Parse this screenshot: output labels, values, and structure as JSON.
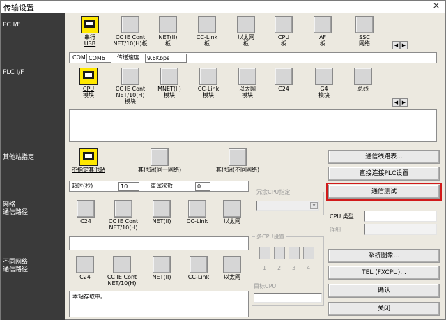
{
  "window": {
    "title": "传输设置",
    "close": "×"
  },
  "sidebar": {
    "pc_if": "PC I/F",
    "plc_if": "PLC I/F",
    "other_station": "其他站指定",
    "network_route": "网络\n通信路径",
    "diff_network_route": "不同网络\n通信路径"
  },
  "pc_if": {
    "devices": [
      {
        "label": "串行\nUSB"
      },
      {
        "label": "CC IE Cont\nNET/10(H)板"
      },
      {
        "label": "NET(II)\n板"
      },
      {
        "label": "CC-Link\n板"
      },
      {
        "label": "以太网\n板"
      },
      {
        "label": "CPU\n板"
      },
      {
        "label": "AF\n板"
      },
      {
        "label": "SSC\n网络"
      }
    ],
    "com_label": "COM",
    "com_value": "COM6",
    "speed_label": "传送速度",
    "speed_value": "9.6Kbps",
    "scroll_left": "◀",
    "scroll_right": "▶"
  },
  "plc_if": {
    "devices": [
      {
        "label": "CPU\n模块"
      },
      {
        "label": "CC IE Cont\nNET/10(H)\n模块"
      },
      {
        "label": "MNET(II)\n模块"
      },
      {
        "label": "CC-Link\n模块"
      },
      {
        "label": "以太网\n模块"
      },
      {
        "label": "C24"
      },
      {
        "label": "G4\n模块"
      },
      {
        "label": "总线"
      }
    ],
    "scroll_left": "◀",
    "scroll_right": "▶"
  },
  "other_station": {
    "devices": [
      {
        "label": "不指定其他站"
      },
      {
        "label": "其他站(同一网络)"
      },
      {
        "label": "其他站(不同网络)"
      }
    ],
    "timeout_label": "超时(秒)",
    "timeout_value": "10",
    "retry_label": "重试次数",
    "retry_value": "0"
  },
  "network_route": {
    "devices": [
      {
        "label": "C24"
      },
      {
        "label": "CC IE Cont\nNET/10(H)"
      },
      {
        "label": "NET(II)"
      },
      {
        "label": "CC-Link"
      },
      {
        "label": "以太网"
      }
    ]
  },
  "diff_network_route": {
    "devices": [
      {
        "label": "C24"
      },
      {
        "label": "CC IE Cont\nNET/10(H)"
      },
      {
        "label": "NET(II)"
      },
      {
        "label": "CC-Link"
      },
      {
        "label": "以太网"
      }
    ]
  },
  "redundant_cpu": {
    "title": "冗余CPU指定"
  },
  "multi_cpu": {
    "title": "多CPU设置",
    "numbers": [
      "1",
      "2",
      "3",
      "4"
    ],
    "target_label": "目标CPU"
  },
  "status_text": "本站存取中。",
  "buttons": {
    "route_list": "通信线路表...",
    "direct_connect": "直接连接PLC设置",
    "comm_test": "通信测试",
    "system_image": "系统图象...",
    "tel": "TEL (FXCPU)...",
    "ok": "确认",
    "close": "关闭"
  },
  "cpu_info": {
    "type_label": "CPU 类型",
    "detail_label": "详细"
  },
  "colors": {
    "sidebar": "#3a3a3a",
    "selected": "#ffe800",
    "highlight": "#d11a1a"
  }
}
